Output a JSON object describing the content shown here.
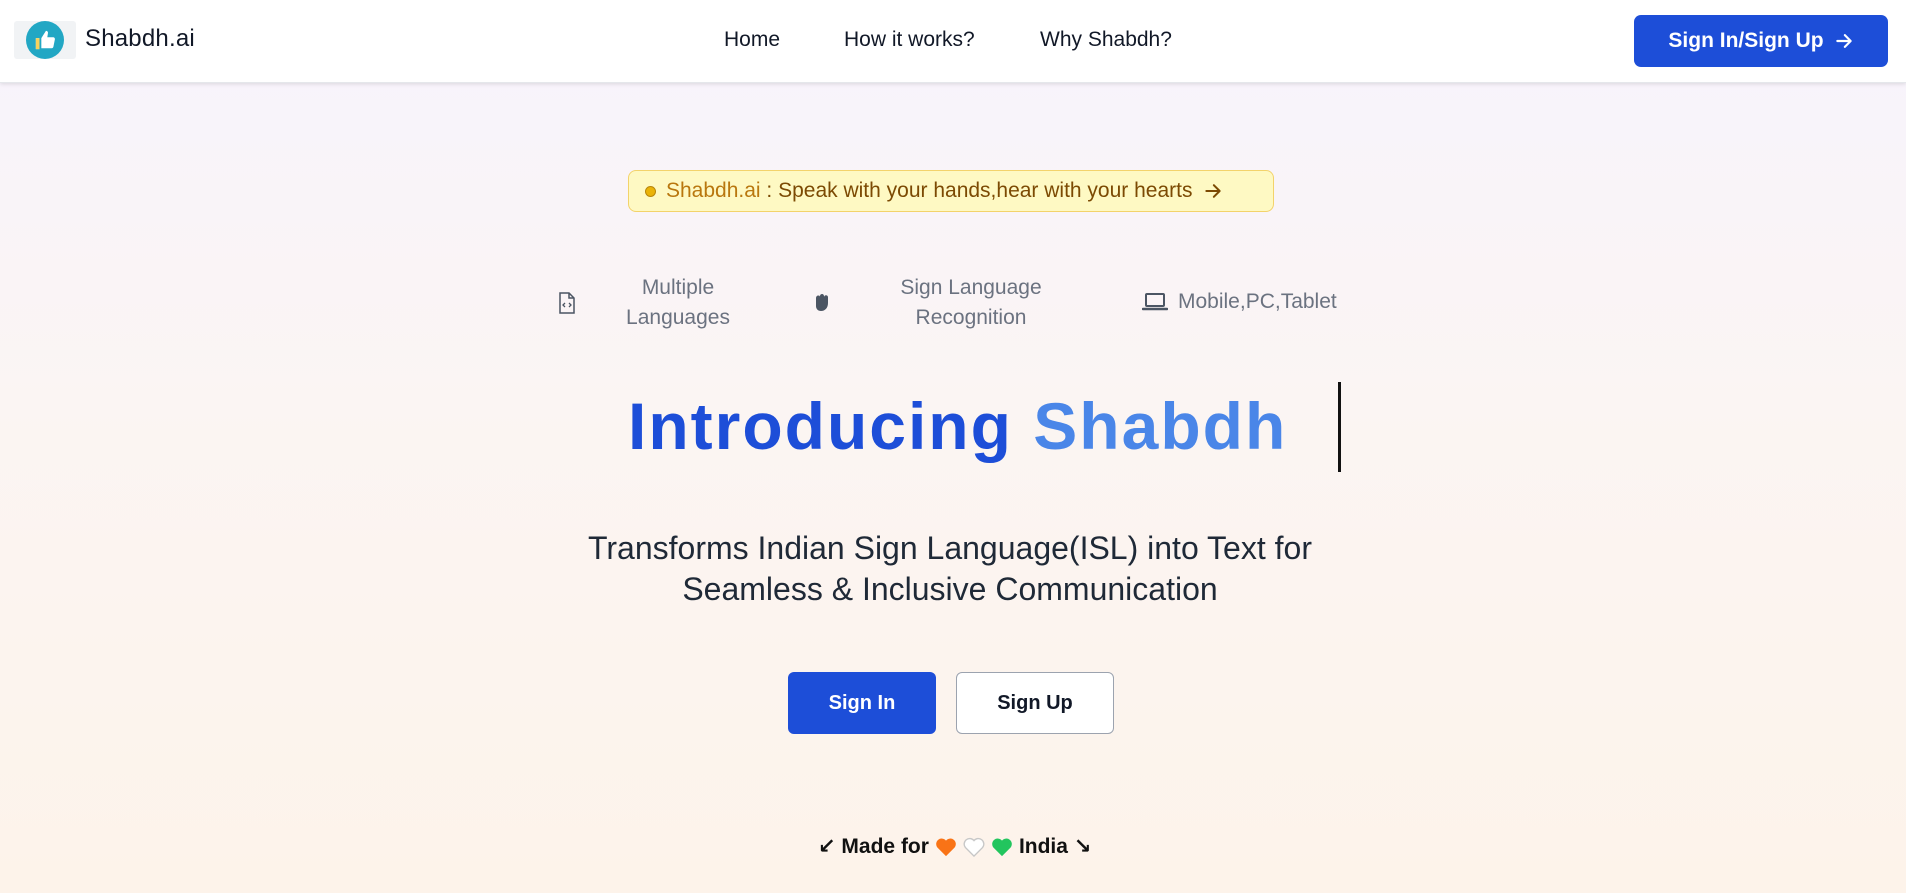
{
  "header": {
    "brand": "Shabdh.ai",
    "nav": [
      "Home",
      "How it works?",
      "Why Shabdh?"
    ],
    "cta_label": "Sign In/Sign Up",
    "cta_icon": "arrow-right-icon"
  },
  "banner": {
    "brand": "Shabdh.ai",
    "text": " : Speak with your hands,hear with your hearts",
    "icon": "arrow-right-icon"
  },
  "features": [
    {
      "icon": "code-file-icon",
      "line1": "Multiple",
      "line2": "Languages"
    },
    {
      "icon": "hand-fist-icon",
      "line1": "Sign Language",
      "line2": "Recognition"
    },
    {
      "icon": "laptop-icon",
      "line1": "Mobile,PC,Tablet"
    }
  ],
  "hero": {
    "heading_part1": "Introducing",
    "heading_part2": "Shabdh",
    "subtitle_line1": "Transforms Indian Sign Language(ISL) into Text for",
    "subtitle_line2": "Seamless & Inclusive Communication"
  },
  "buttons": {
    "signin": "Sign In",
    "signup": "Sign Up"
  },
  "footer": {
    "prefix": "↙ Made for",
    "suffix": "India ↘",
    "heart_colors": [
      "#f97316",
      "#ffffff",
      "#22c55e"
    ]
  },
  "colors": {
    "primary": "#1d4ed8",
    "heading_accent": "#4a86e8",
    "banner_bg": "#fef9c3"
  }
}
